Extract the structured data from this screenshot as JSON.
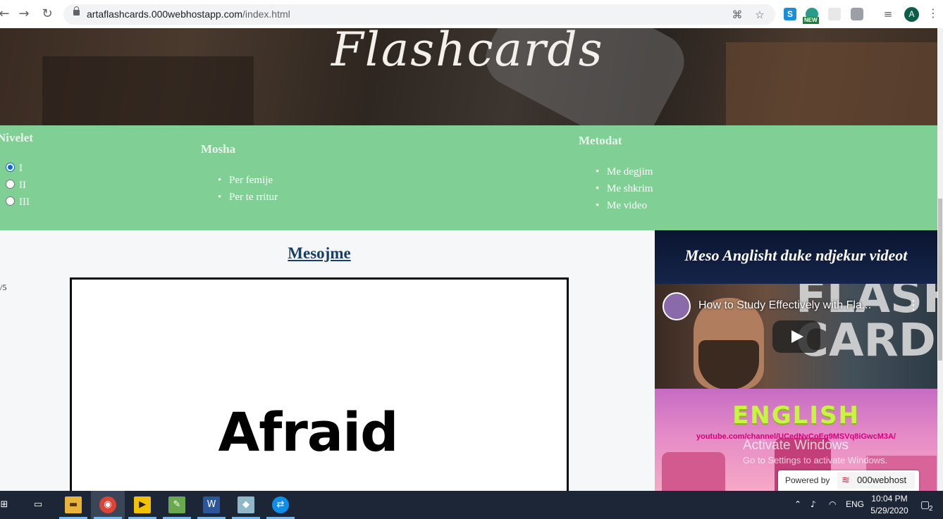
{
  "browser": {
    "url_domain": "artaflashcards.000webhostapp.com",
    "url_path": "/index.html",
    "profile_initial": "A",
    "new_badge": "NEW",
    "extension_letter": "S"
  },
  "hero": {
    "title": "Flashcards"
  },
  "menu": {
    "nivelet": {
      "heading": "Nivelet",
      "options": [
        "I",
        "II",
        "III"
      ],
      "selected": "I"
    },
    "mosha": {
      "heading": "Mosha",
      "items": [
        "Per femije",
        "Per te rritur"
      ]
    },
    "metodat": {
      "heading": "Metodat",
      "items": [
        "Me degjim",
        "Me shkrim",
        "Me video"
      ]
    }
  },
  "main": {
    "title": "Mesojme",
    "counter": "/5",
    "card_word": "Afraid"
  },
  "sidebar": {
    "title": "Meso Anglisht duke ndjekur videot",
    "video1": {
      "title": "How to Study Effectively with Fla...",
      "thumb_text": "FLASH CARDS"
    },
    "video2": {
      "title_text": "ENGLISH",
      "url_text": "youtube.com/channel/UCedNvCoEg9MSVq8iGwcM3A/"
    }
  },
  "overlay": {
    "activate_title": "Activate Windows",
    "activate_sub": "Go to Settings to activate Windows.",
    "powered_by": "Powered by",
    "host_name": "000webhost"
  },
  "taskbar": {
    "language": "ENG",
    "time": "10:04 PM",
    "date": "5/29/2020",
    "notification_count": "2"
  },
  "colors": {
    "menu_band": "#80d095",
    "title_link": "#163e66",
    "taskbar": "#1d2636"
  }
}
